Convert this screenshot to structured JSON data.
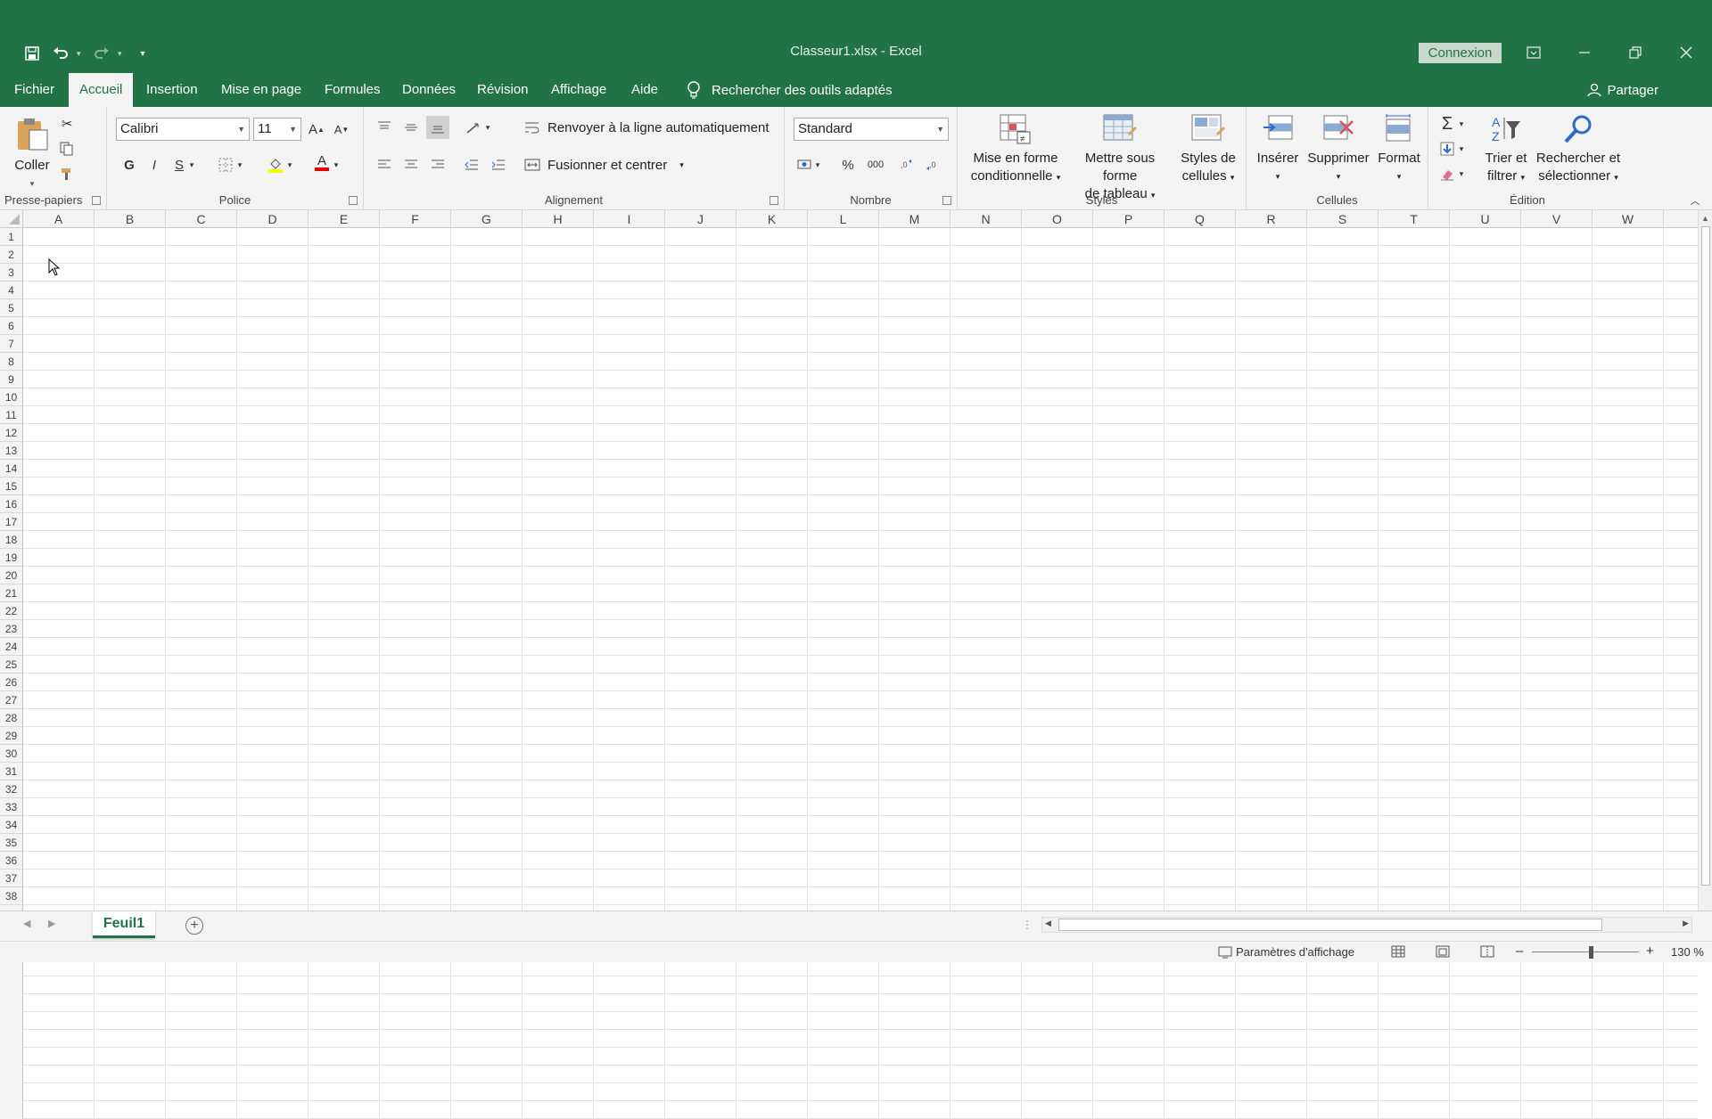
{
  "window": {
    "title": "Classeur1.xlsx  -  Excel",
    "connexion_label": "Connexion"
  },
  "tabs": [
    "Fichier",
    "Accueil",
    "Insertion",
    "Mise en page",
    "Formules",
    "Données",
    "Révision",
    "Affichage",
    "Aide"
  ],
  "active_tab": "Accueil",
  "search_tools_label": "Rechercher des outils adaptés",
  "share_label": "Partager",
  "ribbon": {
    "clipboard": {
      "paste_label": "Coller",
      "group_label": "Presse-papiers"
    },
    "font": {
      "name": "Calibri",
      "size": "11",
      "bold": "G",
      "italic": "I",
      "underline": "S",
      "grow": "A",
      "shrink": "A",
      "font_color_glyph": "A",
      "group_label": "Police"
    },
    "alignment": {
      "wrap_label": "Renvoyer à la ligne automatiquement",
      "merge_label": "Fusionner et centrer",
      "group_label": "Alignement"
    },
    "number": {
      "format": "Standard",
      "percent": "%",
      "thousands": "000",
      "group_label": "Nombre"
    },
    "styles": {
      "conditional_line1": "Mise en forme",
      "conditional_line2": "conditionnelle",
      "table_line1": "Mettre sous forme",
      "table_line2": "de tableau",
      "cell_styles_line1": "Styles de",
      "cell_styles_line2": "cellules",
      "group_label": "Styles"
    },
    "cells": {
      "insert_label": "Insérer",
      "delete_label": "Supprimer",
      "format_label": "Format",
      "group_label": "Cellules"
    },
    "editing": {
      "sort_line1": "Trier et",
      "sort_line2": "filtrer",
      "find_line1": "Rechercher et",
      "find_line2": "sélectionner",
      "group_label": "Édition"
    }
  },
  "grid": {
    "columns": [
      "A",
      "B",
      "C",
      "D",
      "E",
      "F",
      "G",
      "H",
      "I",
      "J",
      "K",
      "L",
      "M",
      "N",
      "O",
      "P",
      "Q",
      "R",
      "S",
      "T",
      "U",
      "V",
      "W"
    ],
    "rows": [
      "1",
      "2",
      "3",
      "4",
      "5",
      "6",
      "7",
      "8",
      "9",
      "10",
      "11",
      "12",
      "13",
      "14",
      "15",
      "16",
      "17",
      "18",
      "19",
      "20",
      "21",
      "22",
      "23",
      "24",
      "25",
      "26",
      "27",
      "28",
      "29",
      "30",
      "31",
      "32",
      "33",
      "34",
      "35",
      "36",
      "37",
      "38"
    ]
  },
  "sheets": [
    "Feuil1"
  ],
  "status": {
    "display_settings": "Paramètres d'affichage",
    "zoom": "130 %",
    "zoom_minus": "–",
    "zoom_plus": "+"
  },
  "colors": {
    "accent": "#217346",
    "ribbon_bg": "#f3f3f3"
  }
}
